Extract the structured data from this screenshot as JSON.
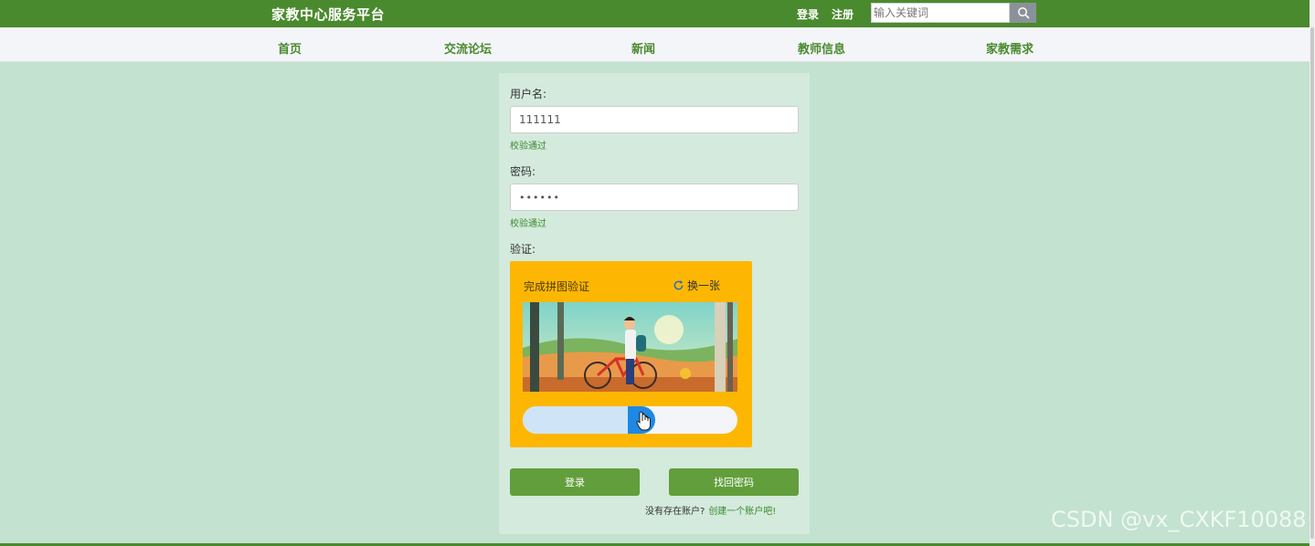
{
  "header": {
    "brand": "家教中心服务平台",
    "login_link": "登录",
    "register_link": "注册",
    "search_placeholder": "输入关键词",
    "search_icon": "search-icon"
  },
  "nav": {
    "items": [
      {
        "label": "首页"
      },
      {
        "label": "交流论坛"
      },
      {
        "label": "新闻"
      },
      {
        "label": "教师信息"
      },
      {
        "label": "家教需求"
      }
    ]
  },
  "form": {
    "username_label": "用户名:",
    "username_value": "111111",
    "username_hint": "校验通过",
    "password_label": "密码:",
    "password_value": "••••••",
    "password_hint": "校验通过",
    "verify_label": "验证:",
    "captcha": {
      "title": "完成拼图验证",
      "refresh_label": "换一张",
      "refresh_icon": "refresh-icon",
      "slider_progress": 0.56,
      "image_icon": "puzzle-image"
    },
    "login_button": "登录",
    "forgot_button": "找回密码",
    "signup_prompt": "没有存在账户?",
    "signup_link": "创建一个账户吧!"
  },
  "watermark": "CSDN @vx_CXKF10088",
  "colors": {
    "header_bg": "#4a8a2e",
    "page_bg": "#c3e2cf",
    "panel_bg": "#d4eadd",
    "captcha_bg": "#fdb702",
    "button_bg": "#629e3c",
    "slider_knob": "#1e88e5"
  }
}
